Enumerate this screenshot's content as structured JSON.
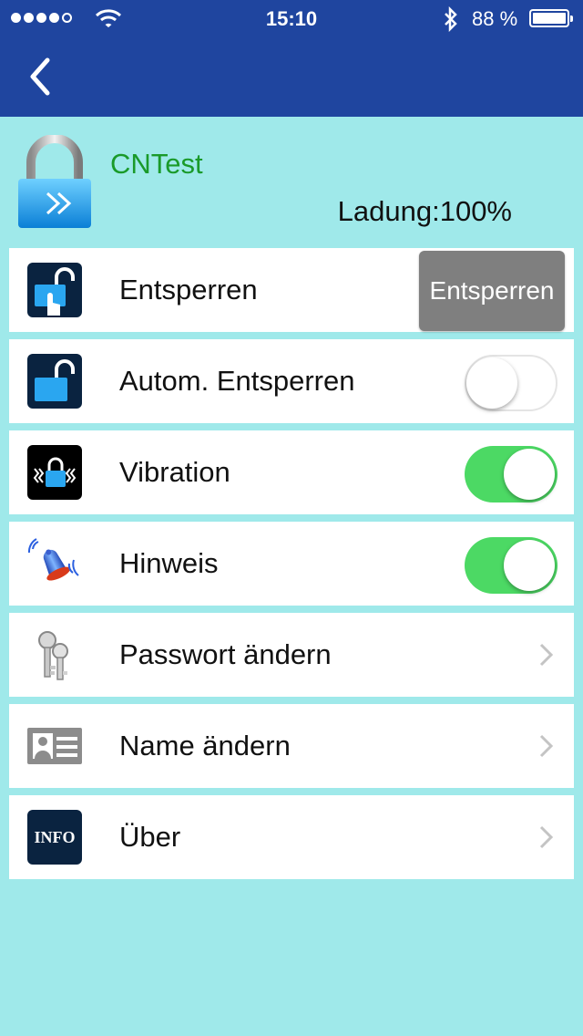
{
  "status_bar": {
    "signal_bars_filled": 4,
    "signal_bars_total": 5,
    "time": "15:10",
    "battery_percent": "88 %"
  },
  "nav": {
    "back_icon": "chevron-left-icon"
  },
  "device": {
    "name": "CNTest",
    "charge": "Ladung:100%",
    "icon": "bluetooth-padlock-icon"
  },
  "rows": [
    {
      "label": "Entsperren",
      "icon": "unlock-touch-icon",
      "control": "button",
      "button_label": "Entsperren"
    },
    {
      "label": "Autom. Entsperren",
      "icon": "unlock-icon",
      "control": "toggle",
      "on": false
    },
    {
      "label": "Vibration",
      "icon": "vibration-lock-icon",
      "control": "toggle",
      "on": true
    },
    {
      "label": "Hinweis",
      "icon": "bell-icon",
      "control": "toggle",
      "on": true
    },
    {
      "label": "Passwort ändern",
      "icon": "keys-icon",
      "control": "chevron"
    },
    {
      "label": "Name ändern",
      "icon": "id-card-icon",
      "control": "chevron"
    },
    {
      "label": "Über",
      "icon": "info-icon",
      "control": "chevron",
      "icon_text": "INFO"
    }
  ],
  "colors": {
    "header": "#1f459f",
    "background": "#9fe9ea",
    "device_name": "#1a9a2a",
    "toggle_on": "#4cd964",
    "button": "#7f7f7f"
  }
}
